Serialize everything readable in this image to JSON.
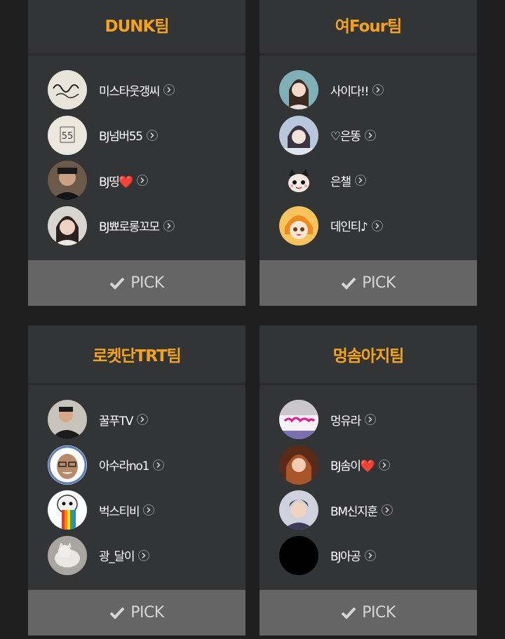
{
  "pick_label": "PICK",
  "teams": [
    {
      "name": "DUNK팀",
      "members": [
        {
          "name": "미스타웃갱씨",
          "avatar": "handwriting-logo"
        },
        {
          "name": "BJ넘버55",
          "avatar": "number-55"
        },
        {
          "name": "BJ띵❤️",
          "avatar": "person-photo"
        },
        {
          "name": "BJ뾰로롱꼬모",
          "avatar": "person-photo"
        }
      ]
    },
    {
      "name": "여Four팀",
      "members": [
        {
          "name": "사이다!!",
          "avatar": "person-photo"
        },
        {
          "name": "♡은똥",
          "avatar": "person-photo"
        },
        {
          "name": "은챌",
          "avatar": "cartoon-character"
        },
        {
          "name": "데인티♪",
          "avatar": "cartoon-character"
        }
      ]
    },
    {
      "name": "로켓단TRT팀",
      "members": [
        {
          "name": "꿀푸TV",
          "avatar": "person-photo"
        },
        {
          "name": "아수라no1",
          "avatar": "cartoon-face-headphones"
        },
        {
          "name": "벅스티비",
          "avatar": "rainbow-ghost"
        },
        {
          "name": "광_달이",
          "avatar": "cat-photo"
        }
      ]
    },
    {
      "name": "멍솜아지팀",
      "members": [
        {
          "name": "멍유라",
          "avatar": "pink-text-logo"
        },
        {
          "name": "BJ솜이❤️",
          "avatar": "person-photo"
        },
        {
          "name": "BM신지훈",
          "avatar": "person-photo"
        },
        {
          "name": "BJ아공",
          "avatar": "black-circle"
        }
      ]
    }
  ]
}
